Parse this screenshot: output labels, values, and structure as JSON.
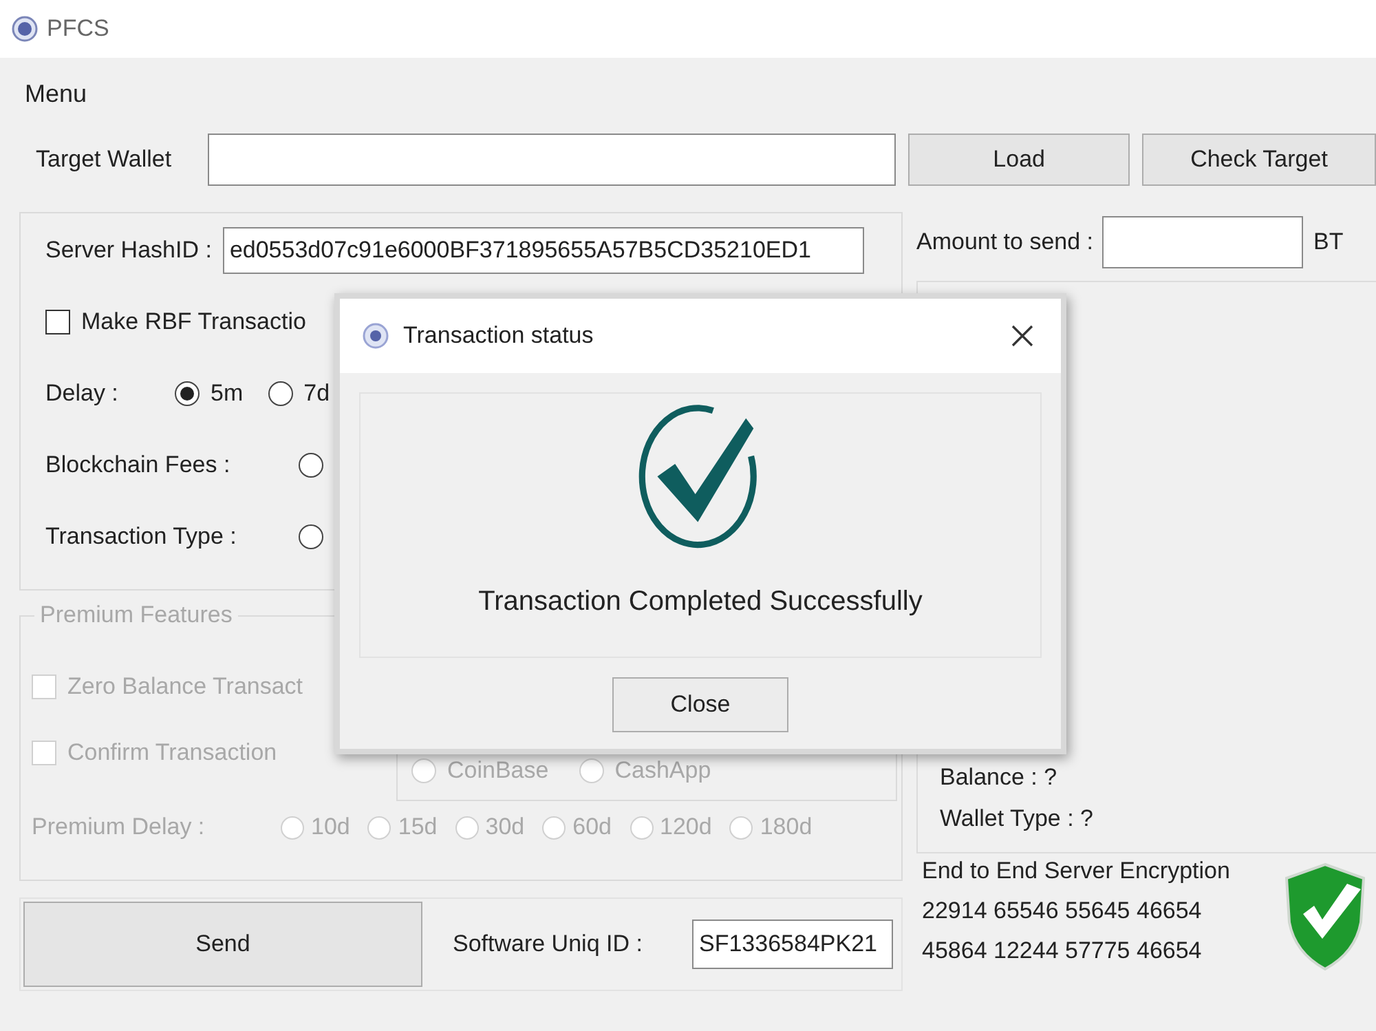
{
  "window": {
    "title": "PFCS"
  },
  "menu": [
    "Menu"
  ],
  "target_wallet": {
    "label": "Target Wallet"
  },
  "top_buttons": [
    "Load",
    "Check Target"
  ],
  "server_hash": {
    "label": "Server HashID :",
    "value": "ed0553d07c91e6000BF371895655A57B5CD35210ED1"
  },
  "rbf": {
    "label": "Make RBF Transactio",
    "checked": false
  },
  "delay": {
    "label": "Delay :",
    "options": [
      {
        "label": "5m",
        "selected": true
      },
      {
        "label": "7d",
        "selected": false
      }
    ]
  },
  "blockchain_fees": {
    "label": "Blockchain Fees :",
    "options": [
      {
        "selected": false
      }
    ]
  },
  "transaction_type": {
    "label": "Transaction Type :",
    "options": [
      {
        "selected": false
      }
    ]
  },
  "amount": {
    "label": "Amount to send :",
    "unit": "BT"
  },
  "premium": {
    "title": "Premium Features",
    "disabled": true,
    "checks": [
      {
        "label": "Zero Balance Transact",
        "checked": false
      },
      {
        "label": "Confirm Transaction",
        "checked": false
      }
    ],
    "providers": [
      {
        "label": "CoinBase",
        "selected": false
      },
      {
        "label": "CashApp",
        "selected": false
      }
    ],
    "delay": {
      "label": "Premium Delay :",
      "options": [
        {
          "label": "10d",
          "selected": false
        },
        {
          "label": "15d",
          "selected": false
        },
        {
          "label": "30d",
          "selected": false
        },
        {
          "label": "60d",
          "selected": false
        },
        {
          "label": "120d",
          "selected": false
        },
        {
          "label": "180d",
          "selected": false
        }
      ]
    }
  },
  "wallet_info": [
    "Balance : ?",
    "Wallet Type : ?"
  ],
  "send_button": "Send",
  "software_id": {
    "label": "Software Uniq ID :",
    "value": "SF1336584PK21"
  },
  "encryption": {
    "title": "End to End Server Encryption",
    "codes": [
      "22914 65546 55645 46654",
      "45864 12244 57775 46654"
    ]
  },
  "dialog": {
    "title": "Transaction status",
    "message": "Transaction Completed Successfully",
    "button": "Close"
  }
}
